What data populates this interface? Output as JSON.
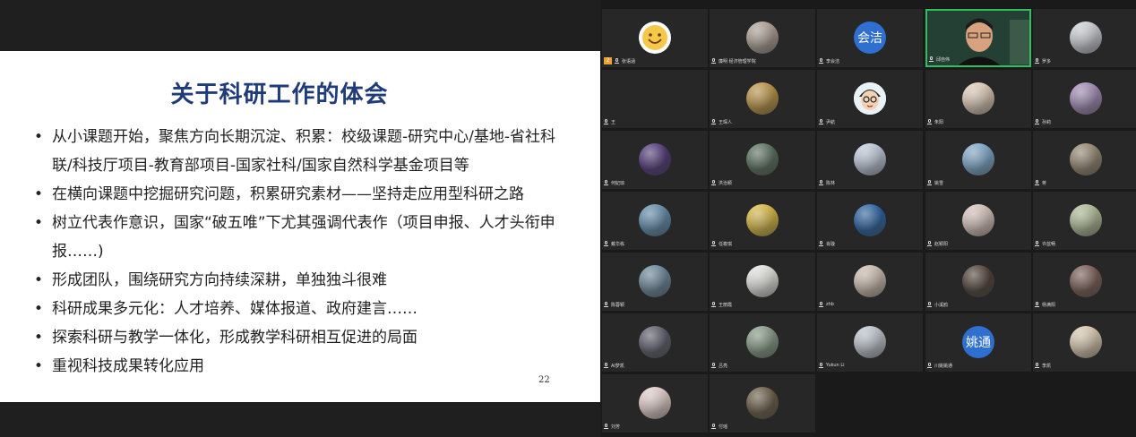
{
  "slide": {
    "title": "关于科研工作的体会",
    "bullets": [
      "从小课题开始，聚焦方向长期沉淀、积累：校级课题-研究中心/基地-省社科联/科技厅项目-教育部项目-国家社科/国家自然科学基金项目等",
      "在横向课题中挖掘研究问题，积累研究素材——坚持走应用型科研之路",
      "树立代表作意识，国家“破五唯”下尤其强调代表作（项目申报、人才头衔申报……)",
      "形成团队，围绕研究方向持续深耕，单独独斗很难",
      "科研成果多元化：人才培养、媒体报道、政府建言……",
      "探索科研与教学一体化，形成教学科研相互促进的局面",
      "重视科技成果转化应用"
    ],
    "page_number": "22"
  },
  "participants": [
    {
      "name": "张语涵",
      "avatar": "smiley-emoji",
      "color": "#f5c84a",
      "badge": "2"
    },
    {
      "name": "廉明 经济管理学院",
      "avatar": "photo",
      "color": "#b7a79a"
    },
    {
      "name": "李会洁",
      "avatar": "text",
      "text": "会洁",
      "color": "#2e6fd0"
    },
    {
      "name": "邱自伟",
      "avatar": "video",
      "color": "#2c4a3a",
      "active": true
    },
    {
      "name": "罗多",
      "avatar": "photo",
      "color": "#d9dde3"
    },
    {
      "name": "王",
      "avatar": "none",
      "color": "#272727"
    },
    {
      "name": "王琛人",
      "avatar": "photo",
      "color": "#c79a3c"
    },
    {
      "name": "尹航",
      "avatar": "cartoon",
      "color": "#e9f2f7"
    },
    {
      "name": "朱阳",
      "avatar": "photo",
      "color": "#f0d9c2"
    },
    {
      "name": "孙莉",
      "avatar": "photo",
      "color": "#a88fbf"
    },
    {
      "name": "何妃琼",
      "avatar": "photo",
      "color": "#4b2f7a"
    },
    {
      "name": "洪治颖",
      "avatar": "photo",
      "color": "#56705a"
    },
    {
      "name": "陈林",
      "avatar": "photo",
      "color": "#c9d6e8"
    },
    {
      "name": "姚雪",
      "avatar": "photo",
      "color": "#7fb0d8"
    },
    {
      "name": "蒋",
      "avatar": "photo",
      "color": "#9a8a70"
    },
    {
      "name": "戴华栋",
      "avatar": "photo",
      "color": "#5f8fb5"
    },
    {
      "name": "任筱琪",
      "avatar": "photo",
      "color": "#e7c33a"
    },
    {
      "name": "肖璇",
      "avatar": "photo",
      "color": "#1f5fa8"
    },
    {
      "name": "赵颖阳",
      "avatar": "photo",
      "color": "#e6cfc7"
    },
    {
      "name": "许蓝畅",
      "avatar": "photo",
      "color": "#b7c79a"
    },
    {
      "name": "陈蓉颖",
      "avatar": "photo",
      "color": "#6a8aa0"
    },
    {
      "name": "王丽霞",
      "avatar": "photo",
      "color": "#f3f3ee"
    },
    {
      "name": "zhb",
      "avatar": "photo",
      "color": "#d8c7b5"
    },
    {
      "name": "小溪鸥",
      "avatar": "photo",
      "color": "#4a3a2e"
    },
    {
      "name": "杨满阳",
      "avatar": "photo",
      "color": "#7a5a50"
    },
    {
      "name": "AI梦凯",
      "avatar": "photo",
      "color": "#5a5a6a"
    },
    {
      "name": "吕亮",
      "avatar": "photo",
      "color": "#8aa08a"
    },
    {
      "name": "Yukun Li",
      "avatar": "photo",
      "color": "#c9d2db"
    },
    {
      "name": "川姚姚通",
      "avatar": "text",
      "text": "姚通",
      "color": "#2e6fd0"
    },
    {
      "name": "李凯",
      "avatar": "photo",
      "color": "#e8d6b8"
    },
    {
      "name": "刘芳",
      "avatar": "photo",
      "color": "#f3dcd6"
    },
    {
      "name": "付瑶",
      "avatar": "photo",
      "color": "#6a5a40"
    }
  ]
}
